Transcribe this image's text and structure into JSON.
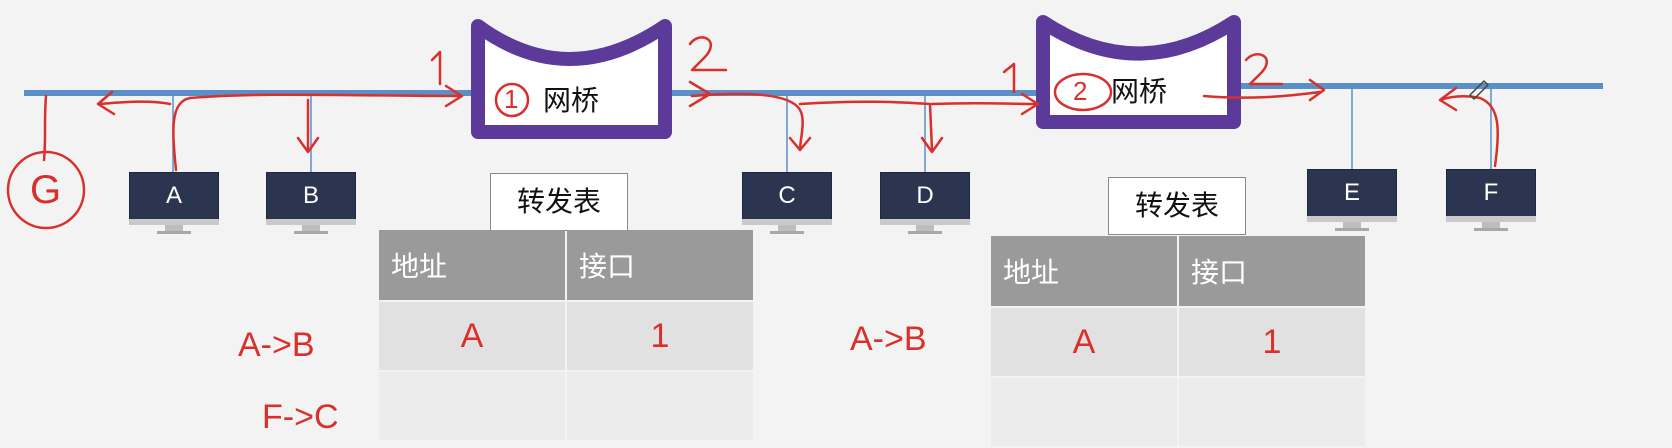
{
  "bridges": [
    {
      "label": "网桥",
      "port1": "1",
      "port2": "2",
      "circled": "1"
    },
    {
      "label": "网桥",
      "port1": "1",
      "port2": "2",
      "circled": "2"
    }
  ],
  "hosts": [
    "A",
    "B",
    "C",
    "D",
    "E",
    "F"
  ],
  "extra_host": "G",
  "tables": [
    {
      "title": "转发表",
      "headers": [
        "地址",
        "接口"
      ],
      "rows": [
        [
          "A",
          "1"
        ],
        [
          "",
          ""
        ]
      ],
      "annotations": [
        "A->B",
        "F->C"
      ]
    },
    {
      "title": "转发表",
      "headers": [
        "地址",
        "接口"
      ],
      "rows": [
        [
          "A",
          "1"
        ],
        [
          "",
          ""
        ]
      ],
      "annotations": [
        "A->B"
      ]
    }
  ],
  "colors": {
    "link": "#5b8fc7",
    "bridge": "#5b3a9a",
    "ink": "#d9302c",
    "screen": "#2b3550"
  }
}
